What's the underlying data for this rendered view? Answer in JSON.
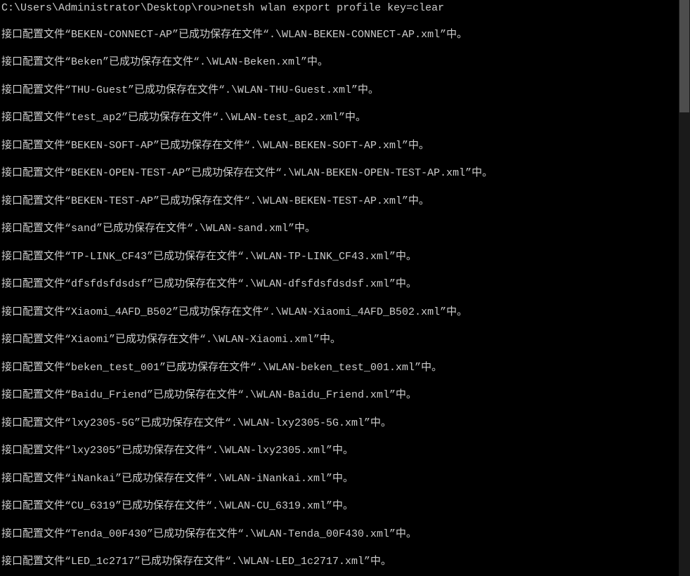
{
  "prompt": "C:\\Users\\Administrator\\Desktop\\rou>",
  "command": "netsh wlan export profile key=clear",
  "prefix": "接口配置文件",
  "middle": "已成功保存在文件",
  "suffix": "中。",
  "openQuote": "“",
  "closeQuote": "”",
  "pathPrefix": ".\\WLAN-",
  "pathSuffix": ".xml",
  "profiles": [
    {
      "name": "BEKEN-CONNECT-AP",
      "file": "BEKEN-CONNECT-AP"
    },
    {
      "name": "Beken",
      "file": "Beken"
    },
    {
      "name": "THU-Guest",
      "file": "THU-Guest"
    },
    {
      "name": "test_ap2",
      "file": "test_ap2"
    },
    {
      "name": "BEKEN-SOFT-AP",
      "file": "BEKEN-SOFT-AP"
    },
    {
      "name": "BEKEN-OPEN-TEST-AP",
      "file": "BEKEN-OPEN-TEST-AP"
    },
    {
      "name": "BEKEN-TEST-AP",
      "file": "BEKEN-TEST-AP"
    },
    {
      "name": "sand",
      "file": "sand"
    },
    {
      "name": "TP-LINK_CF43",
      "file": "TP-LINK_CF43"
    },
    {
      "name": "dfsfdsfdsdsf",
      "file": "dfsfdsfdsdsf"
    },
    {
      "name": "Xiaomi_4AFD_B502",
      "file": "Xiaomi_4AFD_B502"
    },
    {
      "name": "Xiaomi",
      "file": "Xiaomi"
    },
    {
      "name": "beken_test_001",
      "file": "beken_test_001"
    },
    {
      "name": "Baidu_Friend",
      "file": "Baidu_Friend"
    },
    {
      "name": "lxy2305-5G",
      "file": "lxy2305-5G"
    },
    {
      "name": "lxy2305",
      "file": "lxy2305"
    },
    {
      "name": "iNankai",
      "file": "iNankai"
    },
    {
      "name": "CU_6319",
      "file": "CU_6319"
    },
    {
      "name": "Tenda_00F430",
      "file": "Tenda_00F430"
    },
    {
      "name": "LED_1c2717",
      "file": "LED_1c2717"
    }
  ]
}
